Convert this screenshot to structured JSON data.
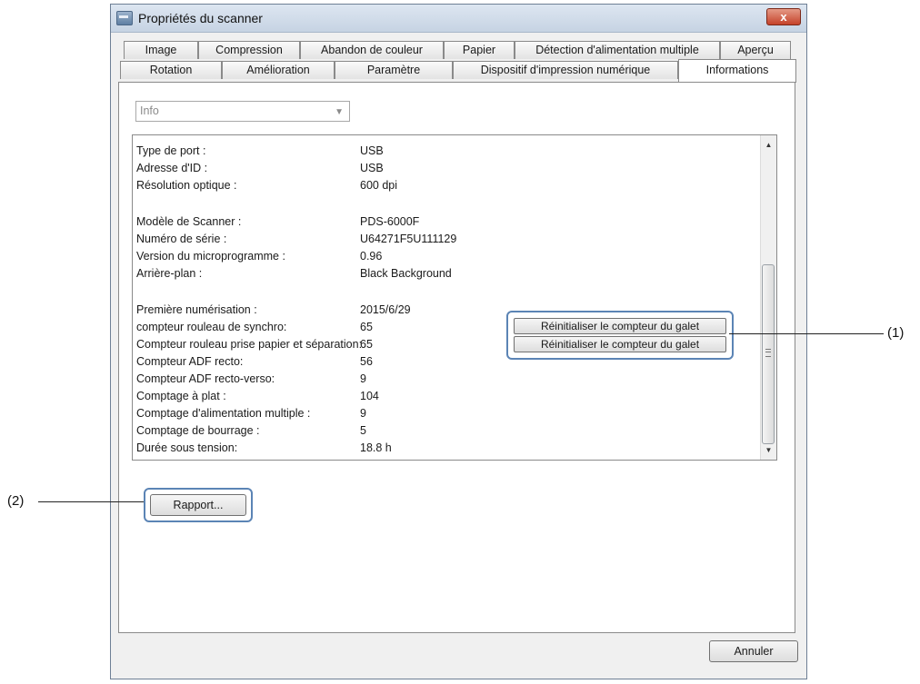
{
  "window": {
    "title": "Propriétés du scanner",
    "close_symbol": "x"
  },
  "tabs_row1": [
    "Image",
    "Compression",
    "Abandon de couleur",
    "Papier",
    "Détection d'alimentation multiple",
    "Aperçu"
  ],
  "tabs_row2": [
    "Rotation",
    "Amélioration",
    "Paramètre",
    "Dispositif d'impression numérique",
    "Informations"
  ],
  "active_tab": "Informations",
  "combo": {
    "value": "Info"
  },
  "info_rows": [
    {
      "label": "Type de port :",
      "value": "USB"
    },
    {
      "label": "Adresse d'ID :",
      "value": "USB"
    },
    {
      "label": "Résolution optique :",
      "value": "600 dpi"
    },
    {
      "label": "Modèle de Scanner :",
      "value": "PDS-6000F"
    },
    {
      "label": "Numéro de série :",
      "value": "U64271F5U111129"
    },
    {
      "label": "Version du microprogramme :",
      "value": "0.96"
    },
    {
      "label": "Arrière-plan :",
      "value": "Black Background"
    },
    {
      "label": "Première numérisation :",
      "value": "2015/6/29"
    },
    {
      "label": "compteur rouleau de synchro:",
      "value": "65"
    },
    {
      "label": "Compteur rouleau prise papier et séparation:",
      "value": "65"
    },
    {
      "label": "Compteur ADF recto:",
      "value": "56"
    },
    {
      "label": "Compteur ADF recto-verso:",
      "value": "9"
    },
    {
      "label": "Comptage à plat :",
      "value": "104"
    },
    {
      "label": "Comptage d'alimentation multiple :",
      "value": "9"
    },
    {
      "label": "Comptage de bourrage :",
      "value": "5"
    },
    {
      "label": "Durée sous tension:",
      "value": "18.8 h"
    }
  ],
  "reset_buttons": [
    "Réinitialiser le compteur du galet",
    "Réinitialiser le compteur du galet"
  ],
  "report_button": "Rapport...",
  "cancel_button": "Annuler",
  "callouts": {
    "one": "(1)",
    "two": "(2)"
  }
}
